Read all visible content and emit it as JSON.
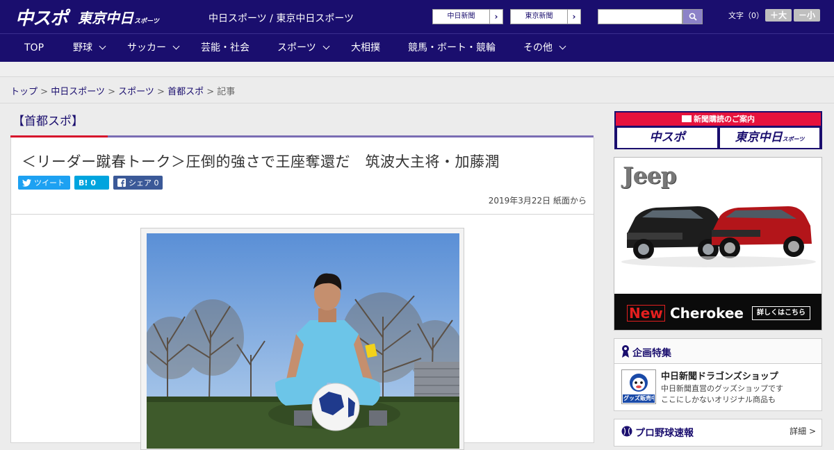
{
  "header": {
    "logo_main": "中スポ",
    "logo_tokyo": "東京中日",
    "logo_tokyo_small": "スポーツ",
    "site_name": "中日スポーツ / 東京中日スポーツ",
    "ext_links": [
      {
        "label": "中日新聞"
      },
      {
        "label": "東京新聞"
      }
    ],
    "search": {
      "placeholder": ""
    },
    "font_size_label": "文字（0）",
    "font_bigger": "＋大",
    "font_smaller": "－小"
  },
  "nav": [
    {
      "label": "TOP",
      "has_menu": false
    },
    {
      "label": "野球",
      "has_menu": true
    },
    {
      "label": "サッカー",
      "has_menu": true
    },
    {
      "label": "芸能・社会",
      "has_menu": false
    },
    {
      "label": "スポーツ",
      "has_menu": true
    },
    {
      "label": "大相撲",
      "has_menu": false
    },
    {
      "label": "競馬・ボート・競輪",
      "has_menu": false
    },
    {
      "label": "その他",
      "has_menu": true
    }
  ],
  "breadcrumb": {
    "items": [
      "トップ",
      "中日スポーツ",
      "スポーツ",
      "首都スポ"
    ],
    "current": "記事",
    "separator": ">"
  },
  "article": {
    "category": "【首都スポ】",
    "headline": "＜リーダー蹴春トーク＞圧倒的強さで王座奪還だ　筑波大主将・加藤潤",
    "share": {
      "tweet_label": "ツイート",
      "hatena_label": "B!",
      "hatena_count": "0",
      "facebook_label": "シェア",
      "facebook_count": "0"
    },
    "date": "2019年3月22日 紙面から"
  },
  "sidebar": {
    "subscribe": {
      "title": "新聞購読のご案内",
      "logo_left": "中スポ",
      "logo_right": "東京中日",
      "logo_right_small": "スポーツ"
    },
    "ad": {
      "brand": "Jeep",
      "new_label": "New",
      "model": "Cherokee",
      "cta": "詳しくはこちら"
    },
    "feature": {
      "title": "企画特集",
      "thumb_label": "グッズ販売中",
      "name": "中日新聞ドラゴンズショップ",
      "desc_lines": [
        "中日新聞直営のグッズショップです",
        "ここにしかないオリジナル商品も"
      ]
    },
    "npb": {
      "title": "プロ野球速報",
      "more": "詳細 >"
    }
  },
  "colors": {
    "brand_navy": "#1a0e6e",
    "accent_red": "#d6102b",
    "accent_purple": "#7a6db4",
    "twitter": "#1da1f2",
    "hatena": "#00a4de",
    "facebook": "#3b5998"
  }
}
